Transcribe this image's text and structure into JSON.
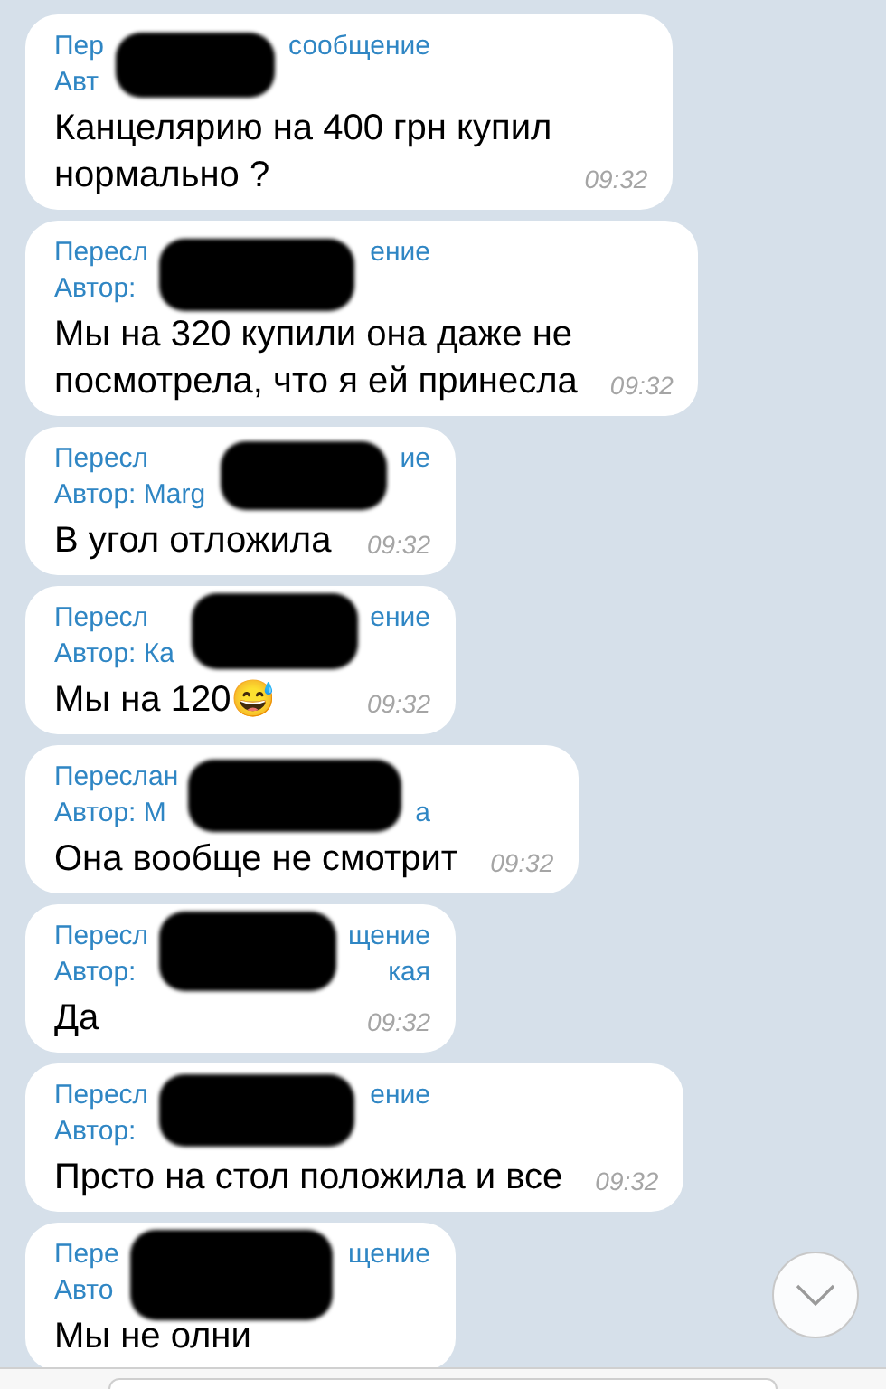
{
  "messages": [
    {
      "forwarded": [
        "Пер",
        "сообщение"
      ],
      "author": [
        "Авт"
      ],
      "lines": [
        "Канцелярию на 400 грн купил",
        "нормально ?"
      ],
      "time": "09:32"
    },
    {
      "forwarded": [
        "Пересл",
        "ение"
      ],
      "author": [
        "Автор:"
      ],
      "lines": [
        "Мы на 320 купили она даже не",
        "посмотрела, что я ей принесла"
      ],
      "time": "09:32"
    },
    {
      "forwarded": [
        "Пересл",
        "ие"
      ],
      "author": [
        "Автор: Marg"
      ],
      "lines": [
        "В угол отложила"
      ],
      "time": "09:32"
    },
    {
      "forwarded": [
        "Пересл",
        "ение"
      ],
      "author": [
        "Автор: Ка"
      ],
      "lines": [
        "Мы на 120😅"
      ],
      "time": "09:32"
    },
    {
      "forwarded": [
        "Переслан"
      ],
      "author": [
        "Автор: М",
        "а"
      ],
      "lines": [
        "Она вообще не смотрит"
      ],
      "time": "09:32"
    },
    {
      "forwarded": [
        "Пересл",
        "щение"
      ],
      "author": [
        "Автор:",
        "кая"
      ],
      "lines": [
        "Да"
      ],
      "time": "09:32"
    },
    {
      "forwarded": [
        "Пересл",
        "ение"
      ],
      "author": [
        "Автор:"
      ],
      "lines": [
        "Прсто на стол положила и все"
      ],
      "time": "09:32"
    },
    {
      "forwarded": [
        "Пере",
        "щение"
      ],
      "author": [
        "Авто"
      ],
      "lines": [
        "Мы не олни"
      ]
    }
  ]
}
